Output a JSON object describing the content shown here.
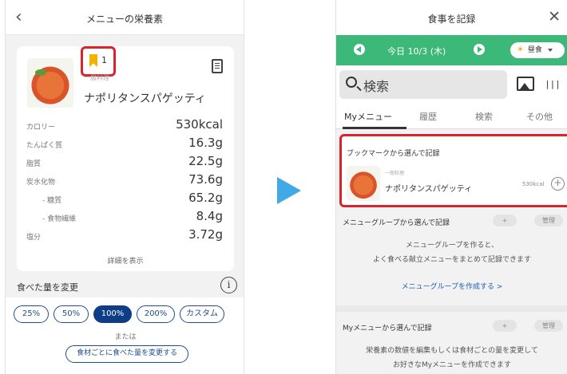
{
  "left": {
    "title": "メニューの栄養素",
    "back_icon": "chevron-left-icon",
    "bookmark_count": "1",
    "food_category": "一般料理",
    "food_name": "ナポリタンスパゲッティ",
    "nutrients": [
      {
        "label": "カロリー",
        "value": "530kcal",
        "sub": false
      },
      {
        "label": "たんぱく質",
        "value": "16.3g",
        "sub": false
      },
      {
        "label": "脂質",
        "value": "22.5g",
        "sub": false
      },
      {
        "label": "炭水化物",
        "value": "73.6g",
        "sub": false
      },
      {
        "label": "- 糖質",
        "value": "65.2g",
        "sub": true
      },
      {
        "label": "- 食物繊維",
        "value": "8.4g",
        "sub": true
      },
      {
        "label": "塩分",
        "value": "3.72g",
        "sub": false
      }
    ],
    "detail_link": "詳細を表示",
    "amount_section_title": "食べた量を変更",
    "info_glyph": "i",
    "amount_options": [
      "25%",
      "50%",
      "100%",
      "200%",
      "カスタム"
    ],
    "selected_amount": "100%",
    "or_text": "または",
    "change_by_ingredient": "食材ごとに食べた量を変更する"
  },
  "right": {
    "title": "食事を記録",
    "close_glyph": "✕",
    "date": "今日 10/3 (木)",
    "meal": "昼食",
    "sun_glyph": "☀",
    "search_placeholder": "検索",
    "barcode_glyph": "|||",
    "tabs": [
      "Myメニュー",
      "履歴",
      "検索",
      "その他"
    ],
    "active_tab": "Myメニュー",
    "bookmark_section_title": "ブックマークから選んで記録",
    "food_category": "一般料理",
    "food_name": "ナポリタンスパゲッティ",
    "food_kcal": "530kcal",
    "add_glyph": "+",
    "menu_group": {
      "title": "メニューグループから選んで記録",
      "add_label": "+",
      "manage_label": "管理",
      "desc_line1": "メニューグループを作ると、",
      "desc_line2": "よく食べる献立メニューをまとめて記録できます",
      "create_link": "メニューグループを作成する >"
    },
    "my_menu": {
      "title": "Myメニューから選んで記録",
      "add_label": "+",
      "manage_label": "管理",
      "desc_line1": "栄養素の数値を編集もしくは食材ごとの量を変更して",
      "desc_line2": "お好きなMyメニューを作成できます"
    }
  },
  "colors": {
    "green": "#3cb878",
    "navy": "#0d3d86",
    "highlight_red": "#d9232d",
    "arrow_blue": "#41a9e6",
    "bookmark_yellow": "#f0b400"
  }
}
